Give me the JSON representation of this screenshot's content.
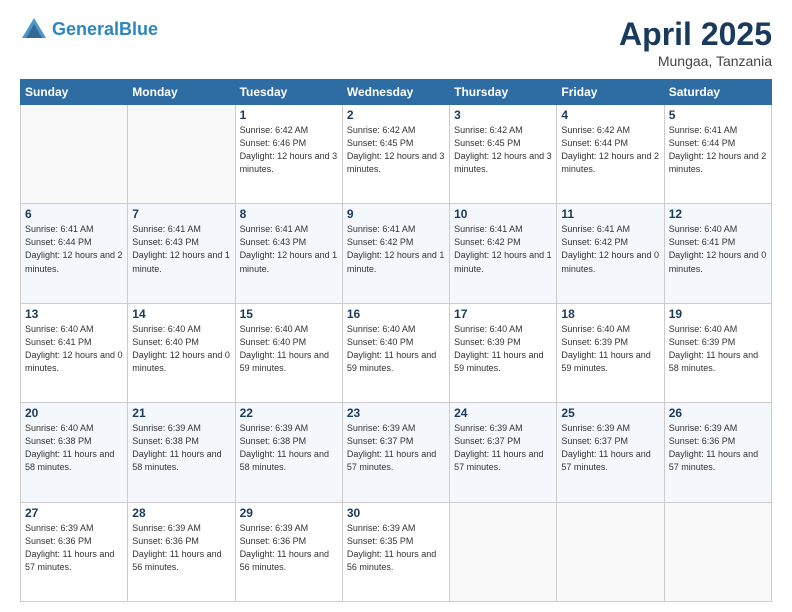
{
  "header": {
    "logo_line1": "General",
    "logo_line2": "Blue",
    "title": "April 2025",
    "subtitle": "Mungaa, Tanzania"
  },
  "days_of_week": [
    "Sunday",
    "Monday",
    "Tuesday",
    "Wednesday",
    "Thursday",
    "Friday",
    "Saturday"
  ],
  "weeks": [
    [
      {
        "day": "",
        "detail": ""
      },
      {
        "day": "",
        "detail": ""
      },
      {
        "day": "1",
        "detail": "Sunrise: 6:42 AM\nSunset: 6:46 PM\nDaylight: 12 hours and 3 minutes."
      },
      {
        "day": "2",
        "detail": "Sunrise: 6:42 AM\nSunset: 6:45 PM\nDaylight: 12 hours and 3 minutes."
      },
      {
        "day": "3",
        "detail": "Sunrise: 6:42 AM\nSunset: 6:45 PM\nDaylight: 12 hours and 3 minutes."
      },
      {
        "day": "4",
        "detail": "Sunrise: 6:42 AM\nSunset: 6:44 PM\nDaylight: 12 hours and 2 minutes."
      },
      {
        "day": "5",
        "detail": "Sunrise: 6:41 AM\nSunset: 6:44 PM\nDaylight: 12 hours and 2 minutes."
      }
    ],
    [
      {
        "day": "6",
        "detail": "Sunrise: 6:41 AM\nSunset: 6:44 PM\nDaylight: 12 hours and 2 minutes."
      },
      {
        "day": "7",
        "detail": "Sunrise: 6:41 AM\nSunset: 6:43 PM\nDaylight: 12 hours and 1 minute."
      },
      {
        "day": "8",
        "detail": "Sunrise: 6:41 AM\nSunset: 6:43 PM\nDaylight: 12 hours and 1 minute."
      },
      {
        "day": "9",
        "detail": "Sunrise: 6:41 AM\nSunset: 6:42 PM\nDaylight: 12 hours and 1 minute."
      },
      {
        "day": "10",
        "detail": "Sunrise: 6:41 AM\nSunset: 6:42 PM\nDaylight: 12 hours and 1 minute."
      },
      {
        "day": "11",
        "detail": "Sunrise: 6:41 AM\nSunset: 6:42 PM\nDaylight: 12 hours and 0 minutes."
      },
      {
        "day": "12",
        "detail": "Sunrise: 6:40 AM\nSunset: 6:41 PM\nDaylight: 12 hours and 0 minutes."
      }
    ],
    [
      {
        "day": "13",
        "detail": "Sunrise: 6:40 AM\nSunset: 6:41 PM\nDaylight: 12 hours and 0 minutes."
      },
      {
        "day": "14",
        "detail": "Sunrise: 6:40 AM\nSunset: 6:40 PM\nDaylight: 12 hours and 0 minutes."
      },
      {
        "day": "15",
        "detail": "Sunrise: 6:40 AM\nSunset: 6:40 PM\nDaylight: 11 hours and 59 minutes."
      },
      {
        "day": "16",
        "detail": "Sunrise: 6:40 AM\nSunset: 6:40 PM\nDaylight: 11 hours and 59 minutes."
      },
      {
        "day": "17",
        "detail": "Sunrise: 6:40 AM\nSunset: 6:39 PM\nDaylight: 11 hours and 59 minutes."
      },
      {
        "day": "18",
        "detail": "Sunrise: 6:40 AM\nSunset: 6:39 PM\nDaylight: 11 hours and 59 minutes."
      },
      {
        "day": "19",
        "detail": "Sunrise: 6:40 AM\nSunset: 6:39 PM\nDaylight: 11 hours and 58 minutes."
      }
    ],
    [
      {
        "day": "20",
        "detail": "Sunrise: 6:40 AM\nSunset: 6:38 PM\nDaylight: 11 hours and 58 minutes."
      },
      {
        "day": "21",
        "detail": "Sunrise: 6:39 AM\nSunset: 6:38 PM\nDaylight: 11 hours and 58 minutes."
      },
      {
        "day": "22",
        "detail": "Sunrise: 6:39 AM\nSunset: 6:38 PM\nDaylight: 11 hours and 58 minutes."
      },
      {
        "day": "23",
        "detail": "Sunrise: 6:39 AM\nSunset: 6:37 PM\nDaylight: 11 hours and 57 minutes."
      },
      {
        "day": "24",
        "detail": "Sunrise: 6:39 AM\nSunset: 6:37 PM\nDaylight: 11 hours and 57 minutes."
      },
      {
        "day": "25",
        "detail": "Sunrise: 6:39 AM\nSunset: 6:37 PM\nDaylight: 11 hours and 57 minutes."
      },
      {
        "day": "26",
        "detail": "Sunrise: 6:39 AM\nSunset: 6:36 PM\nDaylight: 11 hours and 57 minutes."
      }
    ],
    [
      {
        "day": "27",
        "detail": "Sunrise: 6:39 AM\nSunset: 6:36 PM\nDaylight: 11 hours and 57 minutes."
      },
      {
        "day": "28",
        "detail": "Sunrise: 6:39 AM\nSunset: 6:36 PM\nDaylight: 11 hours and 56 minutes."
      },
      {
        "day": "29",
        "detail": "Sunrise: 6:39 AM\nSunset: 6:36 PM\nDaylight: 11 hours and 56 minutes."
      },
      {
        "day": "30",
        "detail": "Sunrise: 6:39 AM\nSunset: 6:35 PM\nDaylight: 11 hours and 56 minutes."
      },
      {
        "day": "",
        "detail": ""
      },
      {
        "day": "",
        "detail": ""
      },
      {
        "day": "",
        "detail": ""
      }
    ]
  ]
}
